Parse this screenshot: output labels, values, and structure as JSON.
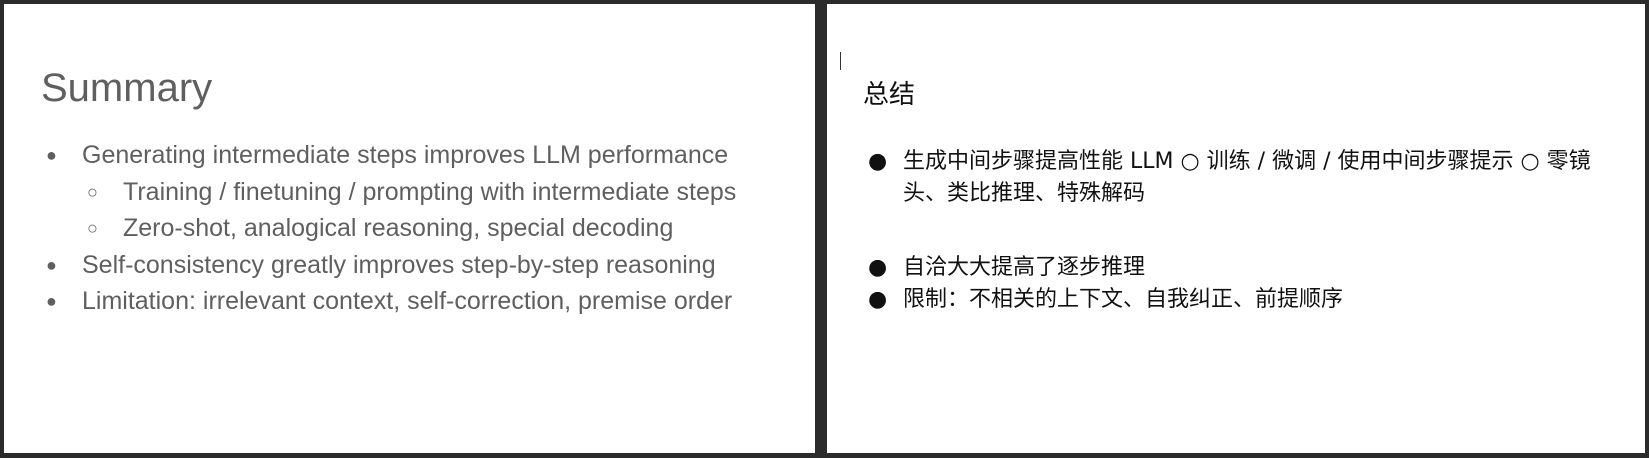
{
  "slides": {
    "original": {
      "title": "Summary",
      "items": [
        {
          "level": 1,
          "bullet": "●",
          "text": "Generating intermediate steps improves LLM performance"
        },
        {
          "level": 2,
          "bullet": "○",
          "text": "Training / finetuning / prompting with intermediate steps"
        },
        {
          "level": 2,
          "bullet": "○",
          "text": "Zero-shot, analogical reasoning, special decoding"
        },
        {
          "level": 1,
          "bullet": "●",
          "text": "Self-consistency greatly improves step-by-step reasoning"
        },
        {
          "level": 1,
          "bullet": "●",
          "text": "Limitation: irrelevant context, self-correction, premise order"
        }
      ]
    },
    "translation": {
      "title": "总结",
      "items": [
        {
          "bullet": "●",
          "text": "生成中间步骤提高性能 LLM ○ 训练 / 微调 / 使用中间步骤提示 ○ 零镜头、类比推理、特殊解码"
        },
        {
          "bullet": "●",
          "text": "自洽大大提高了逐步推理"
        },
        {
          "bullet": "●",
          "text": "限制：不相关的上下文、自我纠正、前提顺序"
        }
      ]
    }
  },
  "colors": {
    "frame": "#2b2b2b",
    "panel": "#ffffff",
    "original_text": "#5f5f5f",
    "translation_text": "#111111"
  }
}
